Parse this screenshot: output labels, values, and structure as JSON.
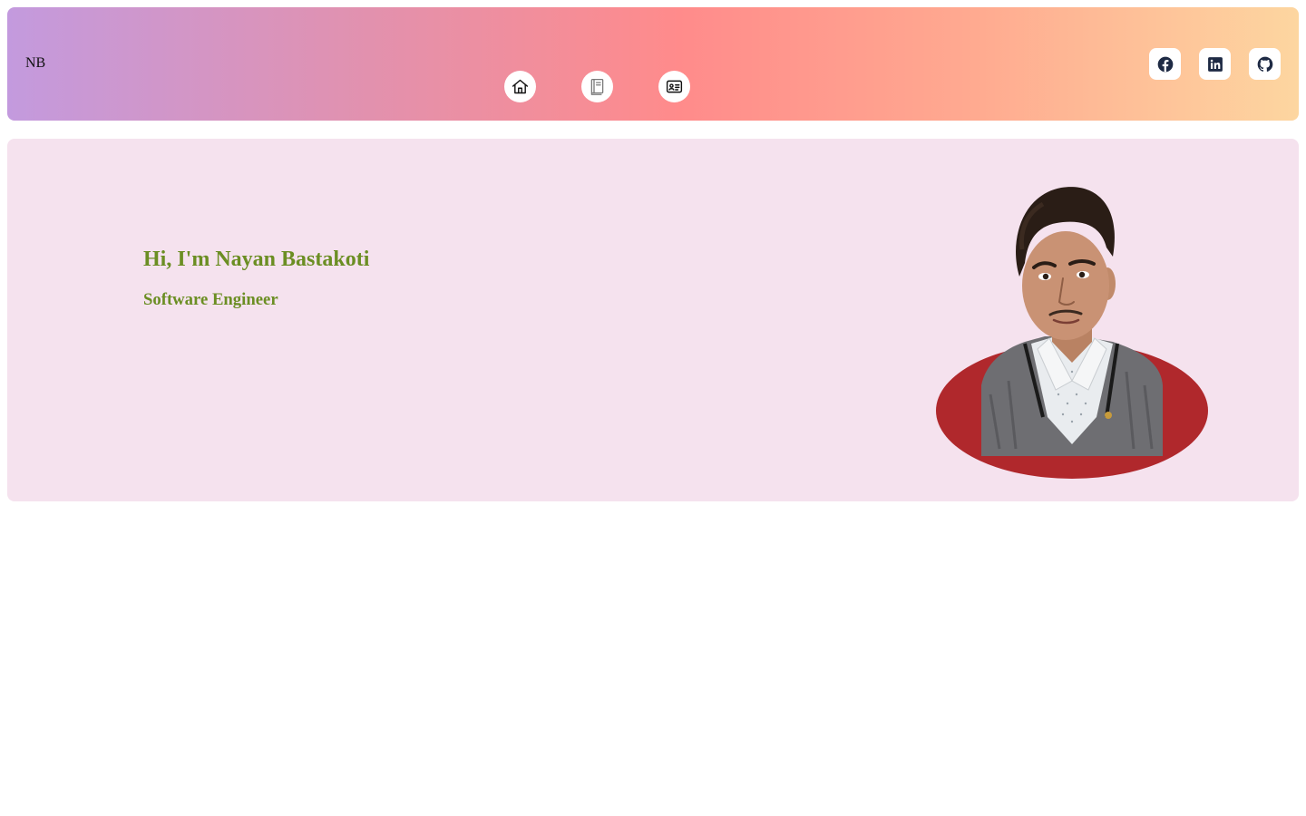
{
  "header": {
    "logo": "NB",
    "nav": [
      {
        "icon": "home-icon"
      },
      {
        "icon": "book-icon"
      },
      {
        "icon": "id-card-icon"
      }
    ],
    "socials": [
      {
        "icon": "facebook-icon"
      },
      {
        "icon": "linkedin-icon"
      },
      {
        "icon": "github-icon"
      }
    ],
    "gradient": [
      "#c39ade",
      "#ff8b8b",
      "#fdd6a0"
    ]
  },
  "hero": {
    "greeting": "Hi, I'm Nayan Bastakoti",
    "role": "Software Engineer",
    "text_color": "#6b8e23",
    "background": "#f5e2ee",
    "portrait_backdrop_color": "#b0282c"
  }
}
